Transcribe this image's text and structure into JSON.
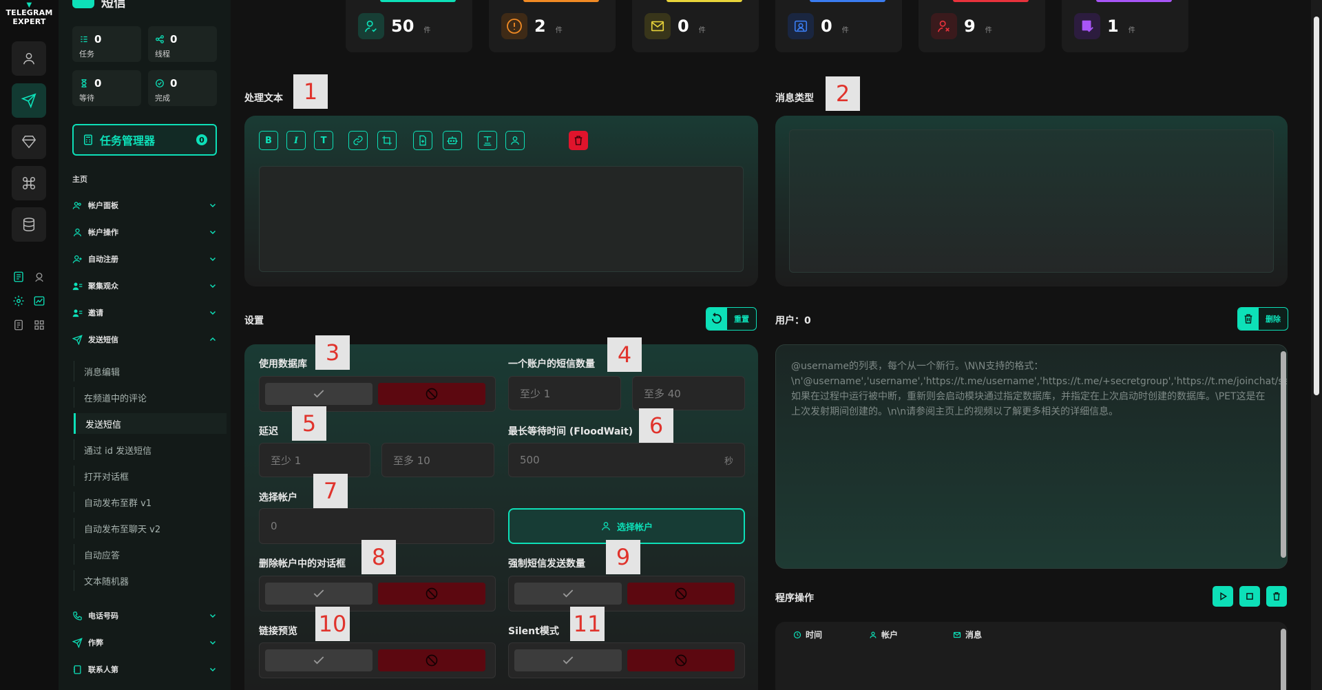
{
  "brand": {
    "line1": "TELEGRAM",
    "line2": "EXPERT"
  },
  "sidebar": {
    "title": "短信",
    "stats": [
      {
        "value": "0",
        "label": "任务"
      },
      {
        "value": "0",
        "label": "线程"
      },
      {
        "value": "0",
        "label": "等待"
      },
      {
        "value": "0",
        "label": "完成"
      }
    ],
    "task_manager": {
      "label": "任务管理器",
      "count": "0"
    },
    "section": "主页",
    "nav": [
      {
        "label": "帐户面板"
      },
      {
        "label": "帐户操作"
      },
      {
        "label": "自动注册"
      },
      {
        "label": "聚集观众"
      },
      {
        "label": "邀请"
      },
      {
        "label": "发送短信"
      },
      {
        "label": "电话号码"
      },
      {
        "label": "作弊"
      },
      {
        "label": "联系人第"
      }
    ],
    "sub_items": [
      {
        "label": "消息编辑"
      },
      {
        "label": "在频道中的评论"
      },
      {
        "label": "发送短信"
      },
      {
        "label": "通过 id 发送短信"
      },
      {
        "label": "打开对话框"
      },
      {
        "label": "自动发布至群 v1"
      },
      {
        "label": "自动发布至聊天 v2"
      },
      {
        "label": "自动应答"
      },
      {
        "label": "文本随机器"
      }
    ]
  },
  "metrics": [
    {
      "value": "50",
      "unit": "件",
      "color": "#0de0b8"
    },
    {
      "value": "2",
      "unit": "件",
      "color": "#f08a24"
    },
    {
      "value": "0",
      "unit": "件",
      "color": "#e8d43a"
    },
    {
      "value": "0",
      "unit": "件",
      "color": "#3a7cf0"
    },
    {
      "value": "9",
      "unit": "件",
      "color": "#e8323c"
    },
    {
      "value": "1",
      "unit": "件",
      "color": "#a855f7"
    }
  ],
  "markers": [
    "1",
    "2",
    "3",
    "4",
    "5",
    "6",
    "7",
    "8",
    "9",
    "10",
    "11"
  ],
  "text_section": {
    "title": "处理文本"
  },
  "msg_type": {
    "title": "消息类型"
  },
  "settings": {
    "title": "设置",
    "reset": "重置",
    "use_db": "使用数据库",
    "sms_per_account": "一个账户的短信数量",
    "sms_min": "至少  1",
    "sms_max": "至多  40",
    "delay": "延迟",
    "delay_min": "至少  1",
    "delay_max": "至多  10",
    "floodwait": "最长等待时间 (FloodWait)",
    "floodwait_value": "500",
    "floodwait_unit": "秒",
    "choose_account": "选择帐户",
    "account_value": "0",
    "choose_account_btn": "选择帐户",
    "delete_dialog": "删除帐户中的对话框",
    "force_count": "强制短信发送数量",
    "link_preview": "链接预览",
    "silent": "Silent模式"
  },
  "users": {
    "title": "用户：0",
    "delete": "删除",
    "placeholder": "@username的列表，每个从一个新行。\\N\\N支持的格式：\\n'@username','username','https://t.me/username','https://t.me/+secretgroup','https://t.me/joinchat/secretgroup'.\\n\\n如果在过程中运行被中断，重新则会启动模块通过指定数据库，并指定在上次启动时创建的数据库。\\PET这是在上次发射期间创建的。\\n\\n请参阅主页上的视频以了解更多相关的详细信息。"
  },
  "program": {
    "title": "程序操作",
    "col_time": "时间",
    "col_account": "帐户",
    "col_message": "消息"
  },
  "accent": "#0de0b8"
}
